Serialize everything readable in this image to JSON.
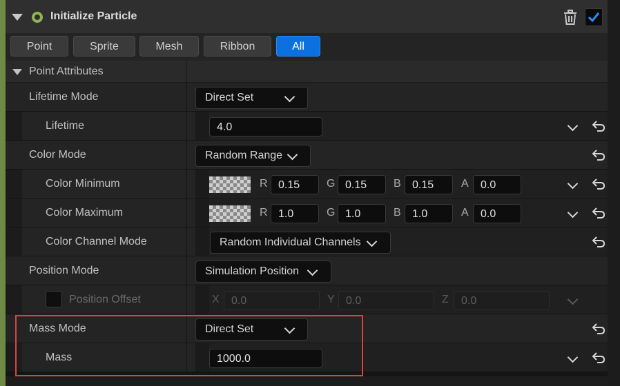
{
  "module": {
    "title": "Initialize Particle",
    "enabled": true
  },
  "tabs": [
    {
      "label": "Point",
      "active": false
    },
    {
      "label": "Sprite",
      "active": false
    },
    {
      "label": "Mesh",
      "active": false
    },
    {
      "label": "Ribbon",
      "active": false
    },
    {
      "label": "All",
      "active": true
    }
  ],
  "section": {
    "label": "Point Attributes"
  },
  "rows": {
    "lifetime_mode": {
      "label": "Lifetime Mode",
      "value": "Direct Set"
    },
    "lifetime": {
      "label": "Lifetime",
      "value": "4.0"
    },
    "color_mode": {
      "label": "Color Mode",
      "value": "Random Range"
    },
    "color_minimum": {
      "label": "Color Minimum",
      "r": "0.15",
      "g": "0.15",
      "b": "0.15",
      "a": "0.0"
    },
    "color_maximum": {
      "label": "Color Maximum",
      "r": "1.0",
      "g": "1.0",
      "b": "1.0",
      "a": "0.0"
    },
    "color_channel_mode": {
      "label": "Color Channel Mode",
      "value": "Random Individual Channels"
    },
    "position_mode": {
      "label": "Position Mode",
      "value": "Simulation Position"
    },
    "position_offset": {
      "label": "Position Offset",
      "x": "0.0",
      "y": "0.0",
      "z": "0.0",
      "enabled": false
    },
    "mass_mode": {
      "label": "Mass Mode",
      "value": "Direct Set"
    },
    "mass": {
      "label": "Mass",
      "value": "1000.0"
    }
  },
  "axis_labels": {
    "r": "R",
    "g": "G",
    "b": "B",
    "a": "A",
    "x": "X",
    "y": "Y",
    "z": "Z"
  },
  "icons": {
    "collapse": "triangle-down-icon",
    "module_status": "ring-icon",
    "delete": "trash-icon",
    "expand": "chevron-down-icon",
    "reset": "reset-arrow-icon"
  },
  "colors": {
    "accent": "#0d70e0",
    "module_strip": "#6e8a45",
    "highlight": "#e0423a"
  }
}
